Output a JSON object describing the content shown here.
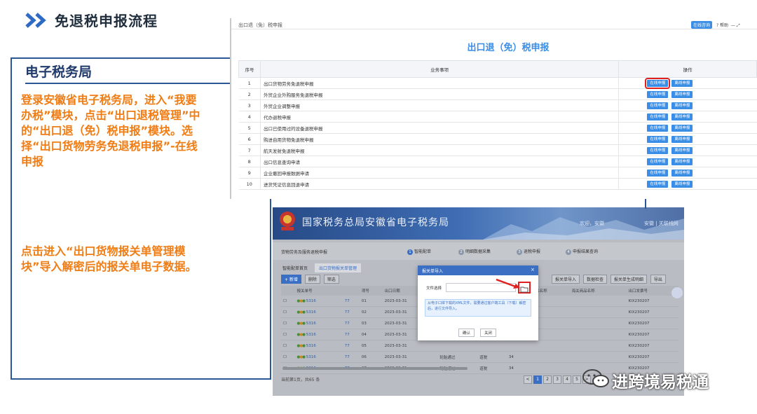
{
  "slide": {
    "title": "免退税申报流程",
    "panel_heading": "电子税务局",
    "para1": "登录安徽省电子税务局，进入“我要办税”模块，点击“出口退税管理”中的“出口退（免）税申报”模块。选择“出口货物劳务免退税申报”-在线申报",
    "para2": "点击进入“出口货物报关单管理模块”导入解密后的报关单电子数据。"
  },
  "declare_screen": {
    "breadcrumb": "出口退（免）税申报",
    "online_consult": "在线咨询",
    "help": "帮助",
    "title": "出口退（免）税申报",
    "col_no": "序号",
    "col_business": "业务事项",
    "col_ops": "操作",
    "online_btn": "在线申报",
    "offline_btn": "离线申报",
    "rows": [
      {
        "no": "1",
        "name": "出口货物劳务免退税申报"
      },
      {
        "no": "2",
        "name": "外贸企业外购服务免退税申报"
      },
      {
        "no": "3",
        "name": "外贸企业调整申报"
      },
      {
        "no": "4",
        "name": "代办退税申报"
      },
      {
        "no": "5",
        "name": "出口已使用过的设备退税申报"
      },
      {
        "no": "6",
        "name": "购进自用货物免退税申报"
      },
      {
        "no": "7",
        "name": "航天发射免退税申报"
      },
      {
        "no": "8",
        "name": "出口信息查询申请"
      },
      {
        "no": "9",
        "name": "企业撤回申报数据申请"
      },
      {
        "no": "10",
        "name": "进货凭证信息回退申请"
      }
    ]
  },
  "bureau_screen": {
    "brand": "国家税务总局安徽省电子税务局",
    "welcome": "欢迎，安徽",
    "top_links": "安徽 | 关联线网",
    "subtitle": "货物劳务及服务退税申报",
    "steps": [
      "智能配单",
      "明细数据采集",
      "退税申报",
      "申报结果查询"
    ],
    "step_nums": [
      "1",
      "2",
      "3",
      "4"
    ],
    "tabs": [
      "智能配单首页",
      "出口货物报关单管理"
    ],
    "toolbar_left": [
      "+ 新增",
      "删除",
      "筛选"
    ],
    "toolbar_right": [
      "报关单导入",
      "数据检查",
      "报关单生成明细",
      "导出"
    ],
    "columns": [
      "",
      "报关单号",
      "",
      "项号",
      "出口日期",
      "数量",
      "",
      "",
      "",
      "",
      "商品名称",
      "海关商品名称",
      "出口发票号"
    ],
    "rows": [
      {
        "code": "5316",
        "t": "77",
        "item": "01",
        "date": "2023-03-31",
        "inv": "KIX230207"
      },
      {
        "code": "5316",
        "t": "77",
        "item": "02",
        "date": "2023-03-31",
        "inv": "KIX230207"
      },
      {
        "code": "5316",
        "t": "77",
        "item": "03",
        "date": "2023-03-31",
        "inv": "KIX230207"
      },
      {
        "code": "5316",
        "t": "77",
        "item": "04",
        "date": "2023-03-31",
        "inv": "KIX230207"
      },
      {
        "code": "5316",
        "t": "77",
        "item": "05",
        "date": "2023-03-31",
        "inv": "KIX230207"
      },
      {
        "code": "5316",
        "t": "77",
        "item": "06",
        "date": "2023-03-31",
        "inv": "KIX230207"
      },
      {
        "code": "5316",
        "t": "77",
        "item": "07",
        "date": "2023-03-31",
        "inv": "KIX230207"
      }
    ],
    "extra_row": {
      "a": "轮胎通过",
      "b": "道税",
      "c": "34"
    },
    "footer": "当前第1页，共65 条",
    "pages": [
      "<",
      "1",
      "2",
      "3",
      "4",
      "5",
      ">"
    ],
    "modal": {
      "title": "报关单导入",
      "close": "×",
      "file_label": "文件选择",
      "info": "从电子口岸下载的XML文件，需要通过客户端工具（下载）解密后，进行文件导入。",
      "ok": "确认",
      "cancel": "关闭"
    }
  },
  "watermark": "进跨境易税通",
  "colors": {
    "accent": "#3a8ee6",
    "orange": "#f07c14",
    "navy": "#2b5797",
    "highlight": "#e02020"
  }
}
